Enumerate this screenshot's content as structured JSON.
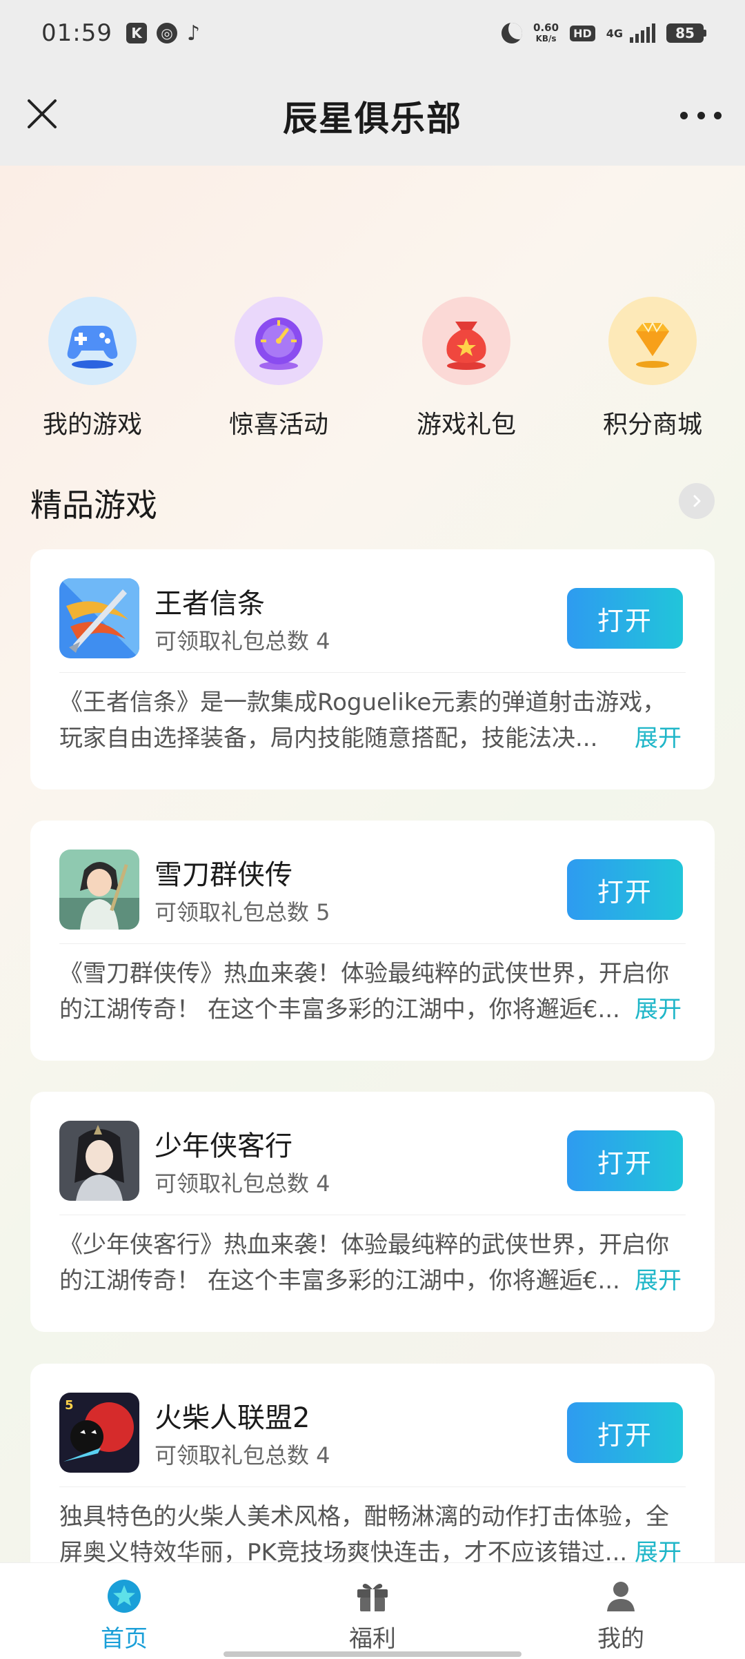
{
  "status_bar": {
    "time": "01:59",
    "net_speed_value": "0.60",
    "net_speed_unit": "KB/s",
    "hd": "HD",
    "network": "4G",
    "battery": "85"
  },
  "navbar": {
    "title": "辰星俱乐部"
  },
  "quick_links": [
    {
      "label": "我的游戏",
      "icon": "gamepad-icon"
    },
    {
      "label": "惊喜活动",
      "icon": "speedometer-icon"
    },
    {
      "label": "游戏礼包",
      "icon": "gift-bag-icon"
    },
    {
      "label": "积分商城",
      "icon": "diamond-icon"
    }
  ],
  "section": {
    "title": "精品游戏"
  },
  "games": [
    {
      "name": "王者信条",
      "gift_count": "可领取礼包总数 4",
      "button": "打开",
      "desc_line1": "《王者信条》是一款集成Roguelike元素的弹道射击游戏，",
      "desc_line2": "玩家自由选择装备，局内技能随意搭配，技能法决...",
      "expand": "展开"
    },
    {
      "name": "雪刀群侠传",
      "gift_count": "可领取礼包总数 5",
      "button": "打开",
      "desc_line1": "《雪刀群侠传》热血来袭！体验最纯粹的武侠世界，开启你",
      "desc_line2": "的江湖传奇！ 在这个丰富多彩的江湖中，你将邂逅€...",
      "expand": "展开"
    },
    {
      "name": "少年侠客行",
      "gift_count": "可领取礼包总数 4",
      "button": "打开",
      "desc_line1": "《少年侠客行》热血来袭！体验最纯粹的武侠世界，开启你",
      "desc_line2": "的江湖传奇！ 在这个丰富多彩的江湖中，你将邂逅€...",
      "expand": "展开"
    },
    {
      "name": "火柴人联盟2",
      "gift_count": "可领取礼包总数 4",
      "button": "打开",
      "desc_line1": "独具特色的火柴人美术风格，酣畅淋漓的动作打击体验，全",
      "desc_line2": "屏奥义特效华丽，PK竞技场爽快连击，才不应该错过...",
      "expand": "展开"
    }
  ],
  "tabbar": {
    "home": "首页",
    "welfare": "福利",
    "mine": "我的"
  },
  "colors": {
    "accent": "#1a9fd8",
    "button_start": "#2e9bf0",
    "button_end": "#21c5da",
    "expand": "#1fb6c8"
  }
}
